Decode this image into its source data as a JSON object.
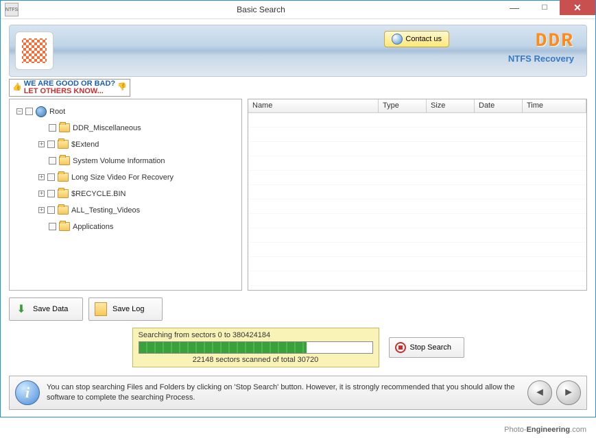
{
  "window": {
    "title": "Basic Search",
    "icon_label": "NTFS"
  },
  "header": {
    "contact_label": "Contact us",
    "brand": "DDR",
    "brand_sub": "NTFS Recovery"
  },
  "feedback": {
    "line1": "WE ARE GOOD OR BAD?",
    "line2": "LET OTHERS KNOW..."
  },
  "tree": {
    "root": "Root",
    "items": [
      "DDR_Miscellaneous",
      "$Extend",
      "System Volume Information",
      "Long Size Video For Recovery",
      "$RECYCLE.BIN",
      "ALL_Testing_Videos",
      "Applications"
    ],
    "expandable": [
      false,
      true,
      false,
      true,
      true,
      true,
      false
    ]
  },
  "file_columns": [
    "Name",
    "Type",
    "Size",
    "Date",
    "Time"
  ],
  "buttons": {
    "save_data": "Save Data",
    "save_log": "Save Log",
    "stop_search": "Stop Search"
  },
  "progress": {
    "label": "Searching from sectors 0 to 380424184",
    "status": "22148  sectors scanned of total 30720"
  },
  "info": "You can stop searching Files and Folders by clicking on 'Stop Search' button. However, it is strongly recommended that you should allow the software to complete the searching Process.",
  "footer": {
    "prefix": "Photo-",
    "main": "Engineering",
    "suffix": ".com"
  }
}
